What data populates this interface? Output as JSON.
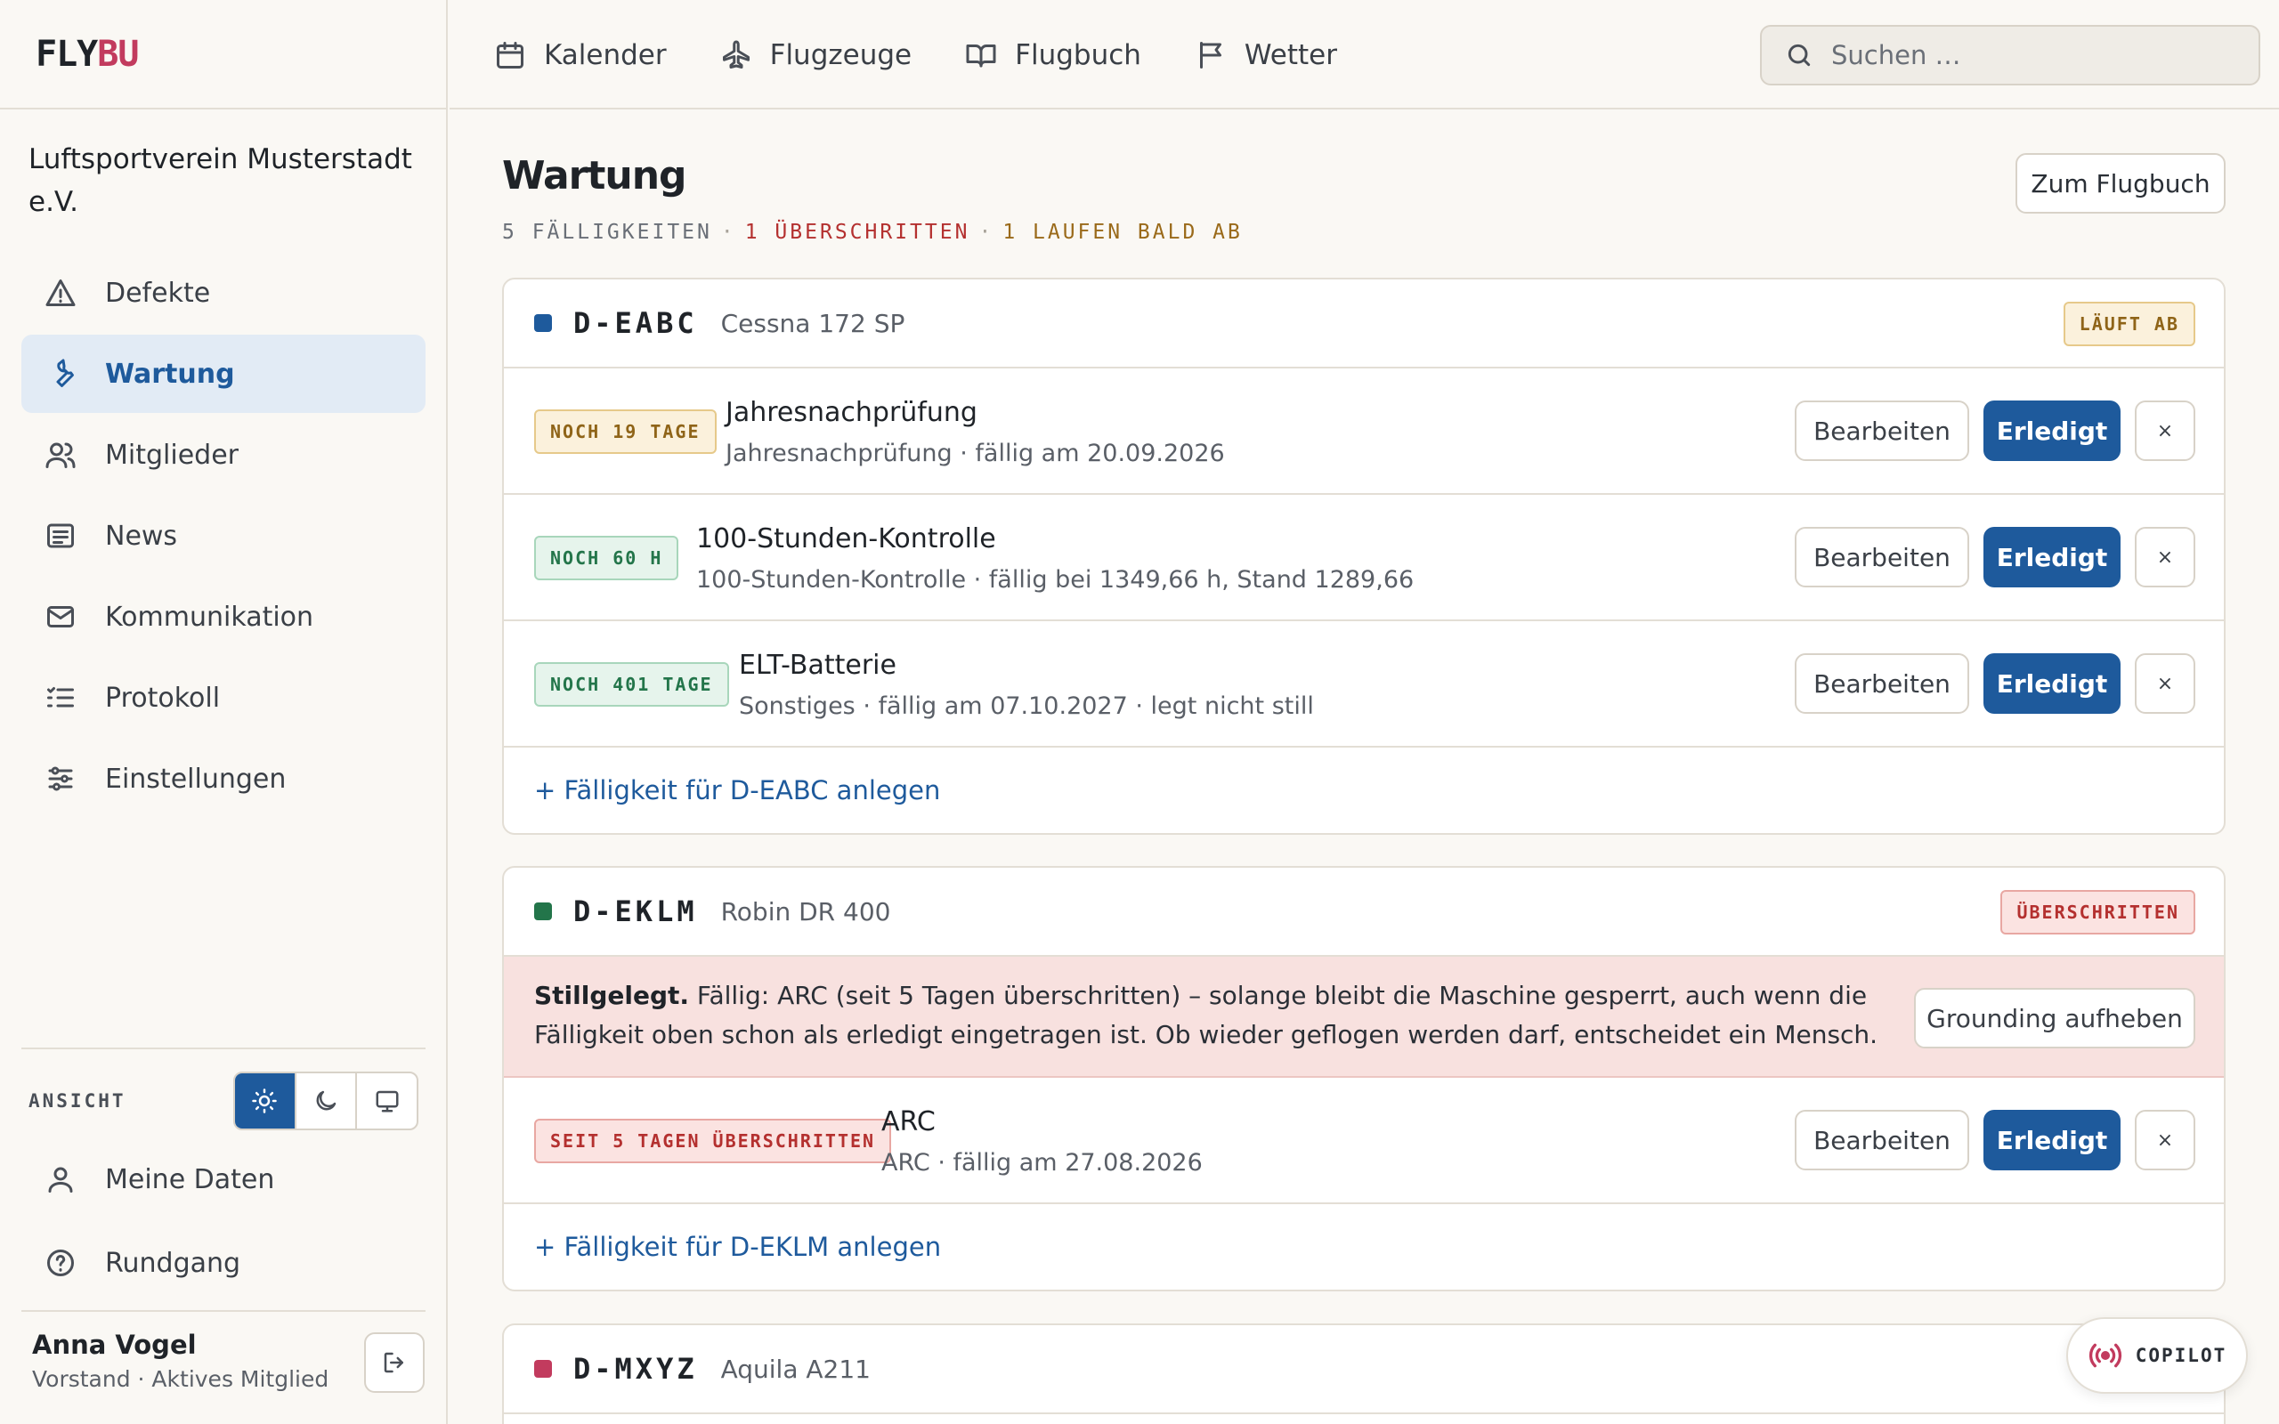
{
  "logo": {
    "part1": "FLY",
    "part2": "BU"
  },
  "org_name": "Luftsportverein Musterstadt e.V.",
  "sidebar": {
    "items": [
      {
        "label": "Defekte",
        "icon": "warning-icon"
      },
      {
        "label": "Wartung",
        "icon": "wrench-icon",
        "active": true
      },
      {
        "label": "Mitglieder",
        "icon": "users-icon"
      },
      {
        "label": "News",
        "icon": "news-icon"
      },
      {
        "label": "Kommunikation",
        "icon": "mail-icon"
      },
      {
        "label": "Protokoll",
        "icon": "list-icon"
      },
      {
        "label": "Einstellungen",
        "icon": "sliders-icon"
      }
    ],
    "view_label": "ANSICHT",
    "meine_daten": "Meine Daten",
    "rundgang": "Rundgang",
    "user": {
      "name": "Anna Vogel",
      "role": "Vorstand · Aktives Mitglied"
    }
  },
  "topnav": {
    "items": [
      {
        "label": "Kalender",
        "icon": "calendar-icon"
      },
      {
        "label": "Flugzeuge",
        "icon": "plane-icon"
      },
      {
        "label": "Flugbuch",
        "icon": "book-icon"
      },
      {
        "label": "Wetter",
        "icon": "flag-icon"
      }
    ],
    "search_placeholder": "Suchen …"
  },
  "page": {
    "title": "Wartung",
    "summary": {
      "count": "5 FÄLLIGKEITEN",
      "sep": "·",
      "overdue": "1 ÜBERSCHRITTEN",
      "soon": "1 LAUFEN BALD AB"
    },
    "btn_flugbuch": "Zum Flugbuch"
  },
  "labels": {
    "edit": "Bearbeiten",
    "done": "Erledigt",
    "remove": "×",
    "grounding": "Grounding aufheben"
  },
  "aircraft": [
    {
      "reg": "D-EABC",
      "model": "Cessna 172 SP",
      "color": "#1e5a9c",
      "status": "LÄUFT AB",
      "items": [
        {
          "badge": "NOCH 19 TAGE",
          "title": "Jahresnachprüfung",
          "sub": "Jahresnachprüfung · fällig am 20.09.2026"
        },
        {
          "badge": "NOCH 60 H",
          "title": "100-Stunden-Kontrolle",
          "sub": "100-Stunden-Kontrolle · fällig bei 1349,66 h, Stand 1289,66"
        },
        {
          "badge": "NOCH 401 TAGE",
          "title": "ELT-Batterie",
          "sub": "Sonstiges · fällig am 07.10.2027 · legt nicht still"
        }
      ],
      "add": "+ Fälligkeit für D-EABC anlegen"
    },
    {
      "reg": "D-EKLM",
      "model": "Robin DR 400",
      "color": "#23754a",
      "status": "ÜBERSCHRITTEN",
      "grounded_bold": "Stillgelegt.",
      "grounded_text": " Fällig: ARC (seit 5 Tagen überschritten) – solange bleibt die Maschine gesperrt, auch wenn die Fälligkeit oben schon als erledigt eingetragen ist. Ob wieder geflogen werden darf, entscheidet ein Mensch.",
      "items": [
        {
          "badge": "SEIT 5 TAGEN ÜBERSCHRITTEN",
          "title": "ARC",
          "sub": "ARC · fällig am 27.08.2026"
        }
      ],
      "add": "+ Fälligkeit für D-EKLM anlegen"
    },
    {
      "reg": "D-MXYZ",
      "model": "Aquila A211",
      "color": "#c23b5e"
    }
  ],
  "copilot": "COPILOT"
}
